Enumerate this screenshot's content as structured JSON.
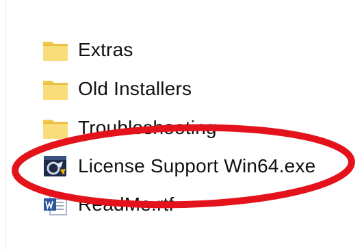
{
  "files": [
    {
      "name": "Extras",
      "icon": "folder-icon"
    },
    {
      "name": "Old Installers",
      "icon": "folder-icon"
    },
    {
      "name": "Troubleshooting",
      "icon": "folder-icon"
    },
    {
      "name": "License Support Win64.exe",
      "icon": "application-exe-icon"
    },
    {
      "name": "ReadMe.rtf",
      "icon": "word-document-icon"
    }
  ],
  "annotation": {
    "shape": "ellipse",
    "color": "#e4131b",
    "highlighted_item": "License Support Win64.exe"
  },
  "colors": {
    "folder": "#f7d76b",
    "folder_shadow": "#e3b93f",
    "word_blue": "#2b579a",
    "exe_dark": "#1e2a48"
  }
}
